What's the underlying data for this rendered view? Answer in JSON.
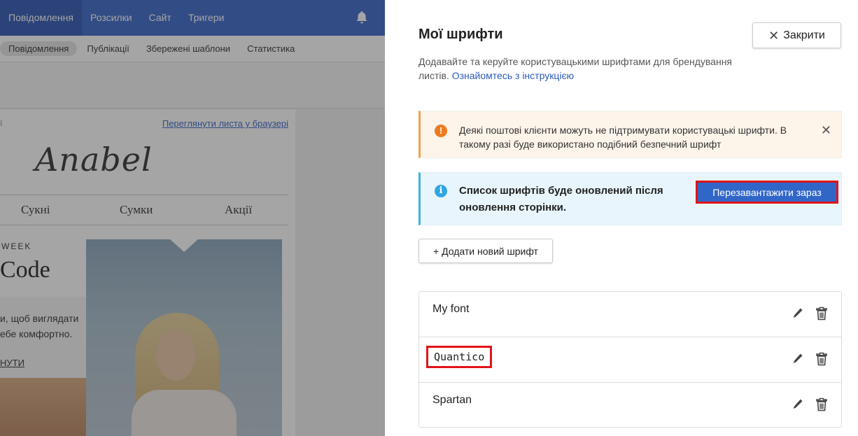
{
  "background_app": {
    "top_nav": [
      "Повідомлення",
      "Розсилки",
      "Сайт",
      "Тригери"
    ],
    "sub_nav": [
      "Повідомлення",
      "Публікації",
      "Збережені шаблони",
      "Статистика"
    ],
    "email_preview": {
      "left_fragment": "ї",
      "browser_link": "Переглянути листа у браузері",
      "logo": "Anabel",
      "menu": [
        "Сукні",
        "Сумки",
        "Акції"
      ],
      "week_label": "WEEK",
      "headline": "Code",
      "body_line1": "и, щоб виглядати",
      "body_line2": "ебе комфортно.",
      "cta": "НУТИ"
    }
  },
  "panel": {
    "title": "Мої шрифти",
    "close_label": "Закрити",
    "description": "Додавайте та керуйте користувацькими шрифтами для брендування листів.",
    "instruction_link": "Ознайомтесь з інструкцією",
    "warning": {
      "text": "Деякі поштові клієнти можуть не підтримувати користувацькі шрифти. В такому разі буде використано подібний безпечний шрифт",
      "icon": "!",
      "dismiss": "✕"
    },
    "info": {
      "text": "Список шрифтів буде оновлений після оновлення сторінки.",
      "icon": "i",
      "button_label": "Перезавантажити зараз"
    },
    "add_font_label": "+ Додати новий шрифт",
    "fonts": [
      "My font",
      "Quantico",
      "Spartan"
    ]
  },
  "colors": {
    "brand_blue": "#3a67c9",
    "highlight_red": "#e0141a",
    "warning_orange": "#ef7b1f",
    "info_blue": "#31a5e2"
  }
}
